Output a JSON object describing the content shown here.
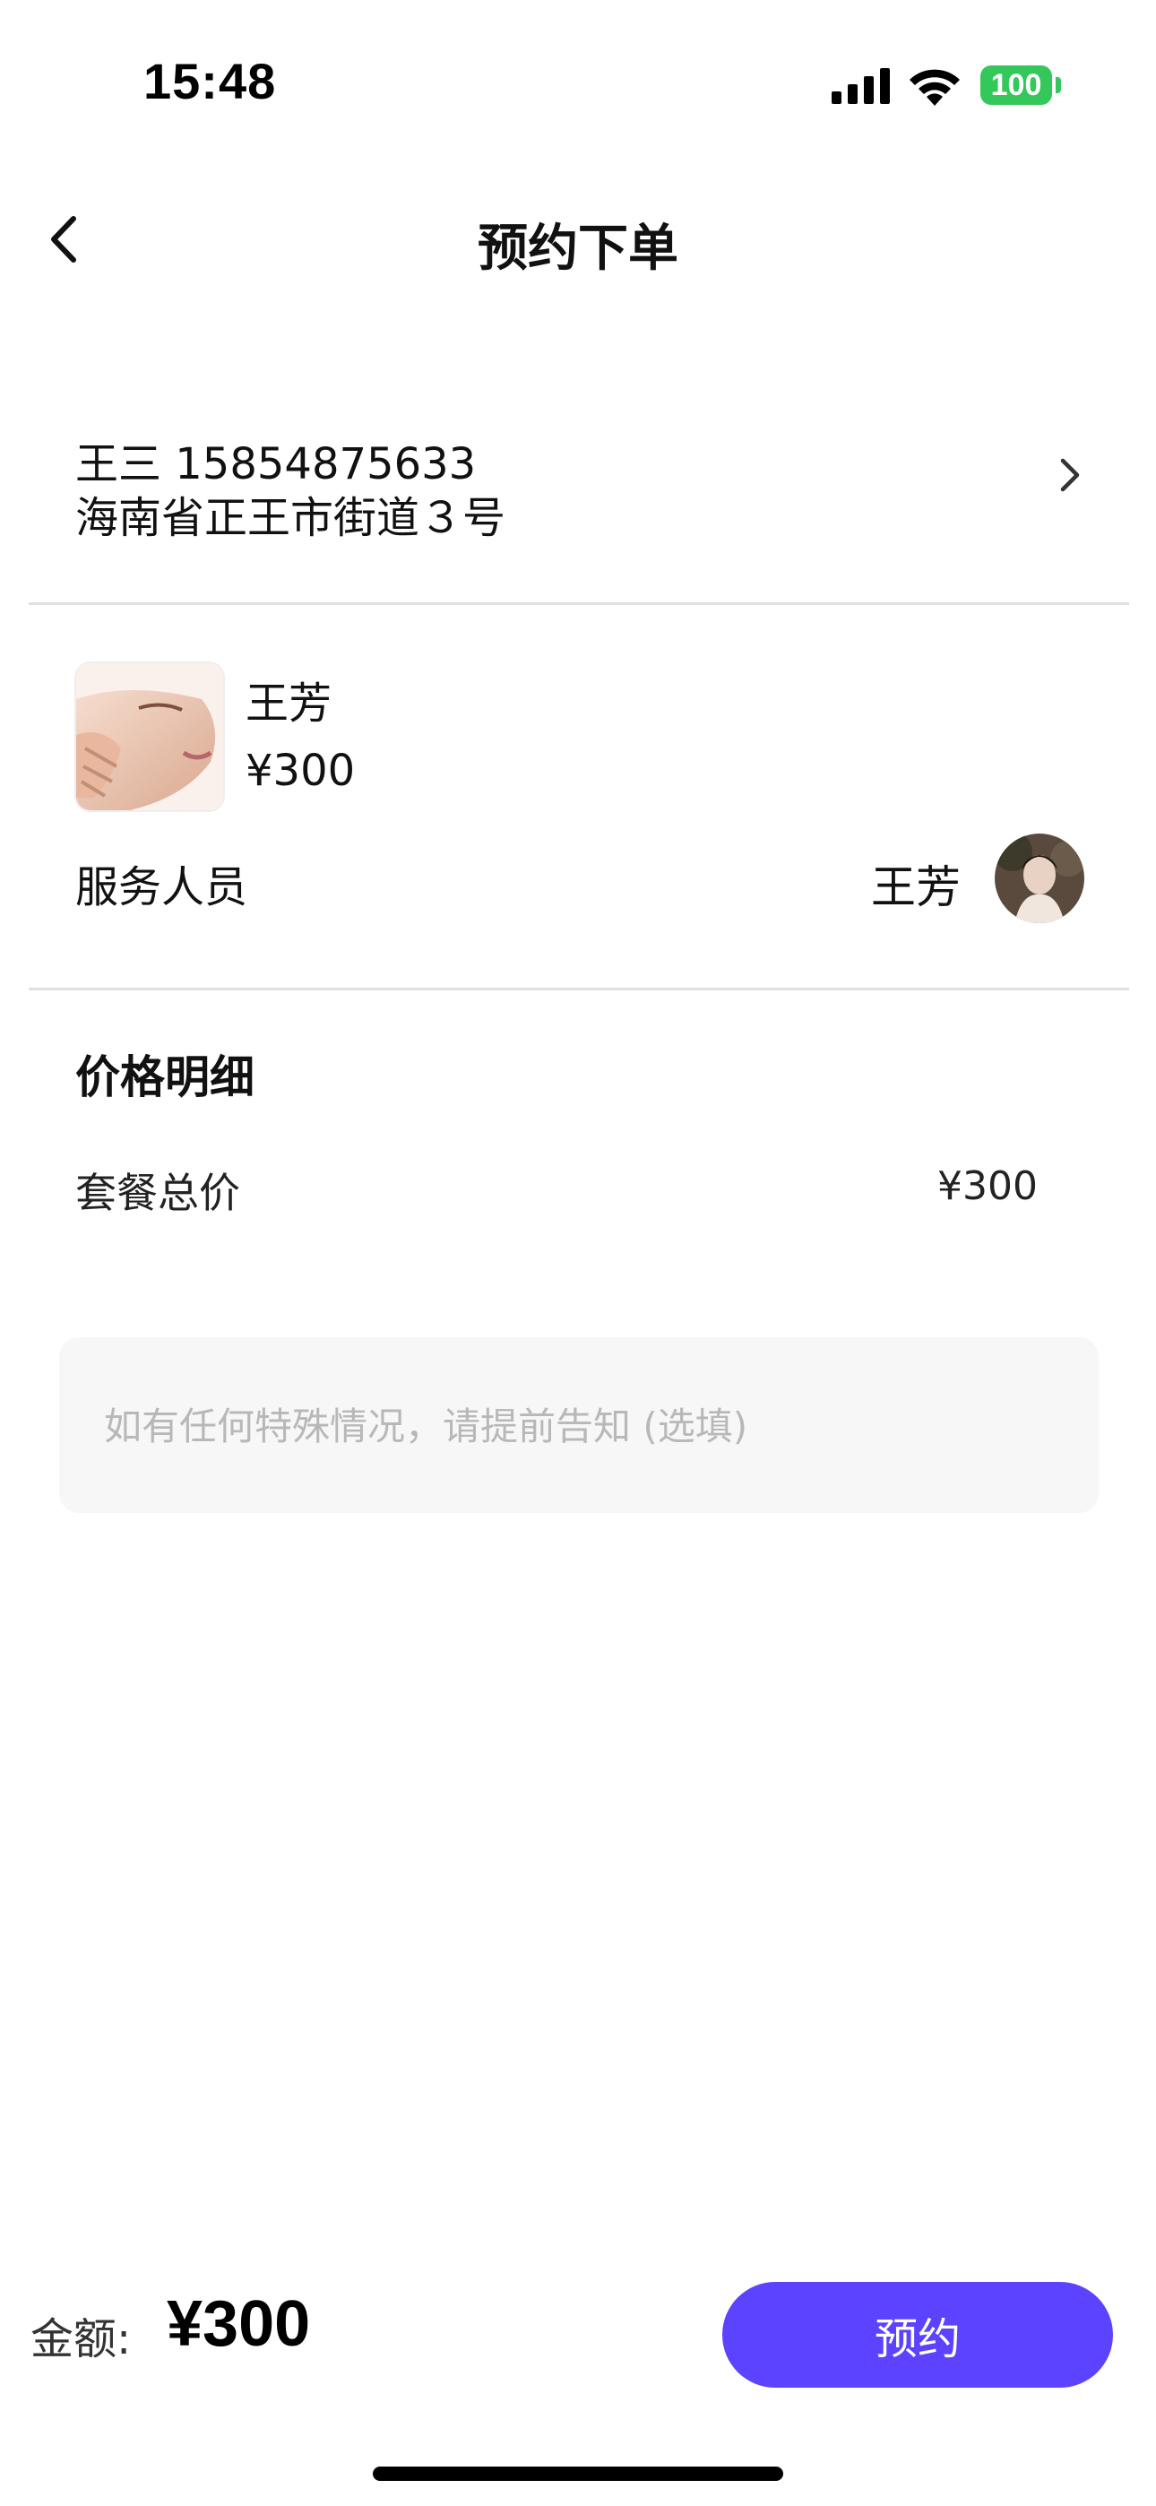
{
  "status_bar": {
    "time": "15:48",
    "battery": "100",
    "icons": [
      "signal-icon",
      "wifi-icon",
      "battery-icon"
    ],
    "battery_color": "#34c759"
  },
  "nav": {
    "title": "预约下单",
    "back_icon": "chevron-left-icon"
  },
  "address": {
    "name_phone": "王三 15854875633",
    "detail": "海南省正王市街道３号",
    "chevron_icon": "chevron-right-icon"
  },
  "service": {
    "name": "王芳",
    "price": "¥300",
    "staff_label": "服务人员",
    "staff_name": "王芳"
  },
  "price_detail": {
    "heading": "价格明细",
    "total_label": "套餐总价",
    "total_value": "¥300"
  },
  "remark": {
    "placeholder": "如有任何特殊情况，请提前告知 (选填)",
    "value": ""
  },
  "footer": {
    "amount_label": "金额:",
    "amount_value": "¥300",
    "book_button": "预约",
    "accent_color": "#5b43ff"
  }
}
